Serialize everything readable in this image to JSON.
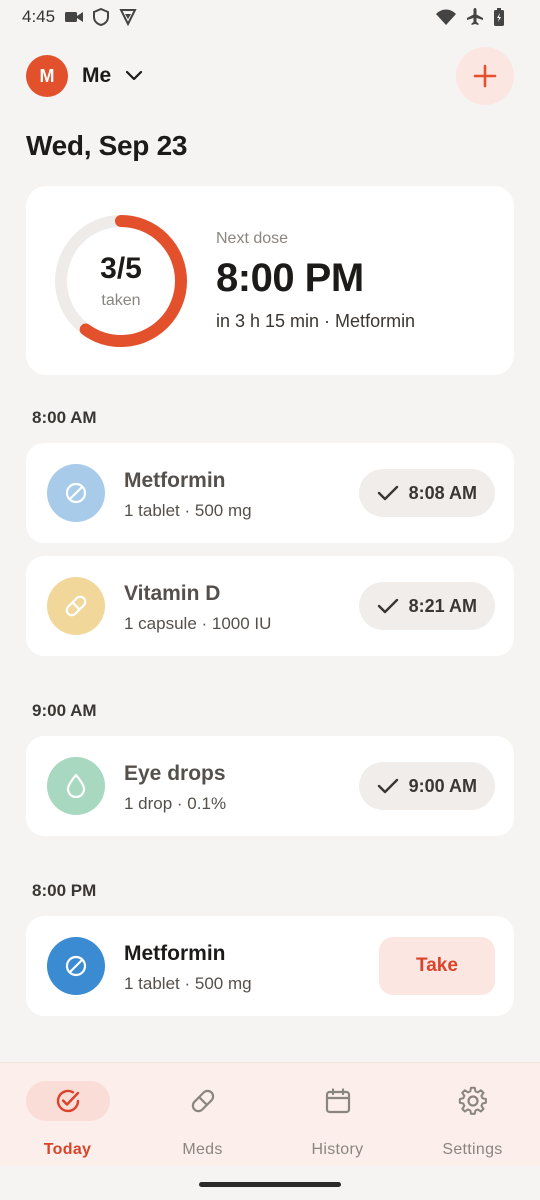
{
  "status": {
    "time": "4:45"
  },
  "header": {
    "avatar_initial": "M",
    "profile_name": "Me"
  },
  "date_title": "Wed, Sep 23",
  "summary": {
    "count": "3/5",
    "count_label": "taken",
    "progress_fraction": 0.6,
    "next_label": "Next dose",
    "next_time": "8:00 PM",
    "next_detail": "in 3 h 15 min · Metformin"
  },
  "sections": [
    {
      "label": "8:00 AM",
      "doses": [
        {
          "name": "Metformin",
          "sub": "1 tablet · 500 mg",
          "taken_time": "8:08 AM",
          "icon": "pill-slash-icon"
        },
        {
          "name": "Vitamin D",
          "sub": "1 capsule · 1000 IU",
          "taken_time": "8:21 AM",
          "icon": "capsule-icon"
        }
      ]
    },
    {
      "label": "9:00 AM",
      "doses": [
        {
          "name": "Eye drops",
          "sub": "1 drop · 0.1%",
          "taken_time": "9:00 AM",
          "icon": "drop-icon"
        }
      ]
    },
    {
      "label": "8:00 PM",
      "doses": [
        {
          "name": "Metformin",
          "sub": "1 tablet · 500 mg",
          "action": "Take",
          "icon": "pill-slash-icon"
        }
      ]
    }
  ],
  "nav": [
    {
      "label": "Today",
      "icon": "check-circle-icon",
      "active": true
    },
    {
      "label": "Meds",
      "icon": "capsule-icon"
    },
    {
      "label": "History",
      "icon": "calendar-icon"
    },
    {
      "label": "Settings",
      "icon": "gear-icon"
    }
  ],
  "colors": {
    "accent": "#e2512c",
    "metformin_taken": "#a9cbea",
    "vitamin_d": "#f2d79b",
    "eye_drops": "#a8d8bf",
    "metformin_active": "#3a8bd2"
  }
}
